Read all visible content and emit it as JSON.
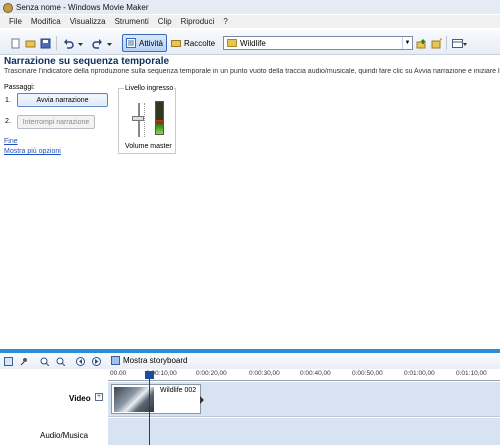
{
  "window": {
    "title": "Senza nome - Windows Movie Maker"
  },
  "menu": [
    "File",
    "Modifica",
    "Visualizza",
    "Strumenti",
    "Clip",
    "Riproduci",
    "?"
  ],
  "toolbar": {
    "tasks_label": "Attività",
    "collections_label": "Raccolte",
    "collection_value": "Wildlife"
  },
  "task": {
    "title": "Narrazione su sequenza temporale",
    "description": "Trascinare l'indicatore della riproduzione sulla sequenza temporale in un punto vuoto della traccia audio/musicale, quindi fare clic su Avvia narrazione e iniziare la n",
    "steps_label": "Passaggi:",
    "step1_num": "1.",
    "step1_button": "Avvia narrazione",
    "step2_num": "2.",
    "step2_button": "Interrompi narrazione",
    "finish_link": "Fine",
    "more_options_link": "Mostra più opzioni"
  },
  "meter": {
    "input_level_label": "Livello ingresso",
    "volume_label": "Volume master",
    "input_level_fraction": 0.45
  },
  "timeline": {
    "storyboard_label": "Mostra storyboard",
    "ruler": [
      "00.00",
      "0:00:10,00",
      "0:00:20,00",
      "0:00:30,00",
      "0:00:40,00",
      "0:00:50,00",
      "0:01:00,00",
      "0:01:10,00"
    ],
    "video_track_label": "Video",
    "audio_track_label": "Audio/Musica",
    "clip_name": "Wildlife 002"
  }
}
